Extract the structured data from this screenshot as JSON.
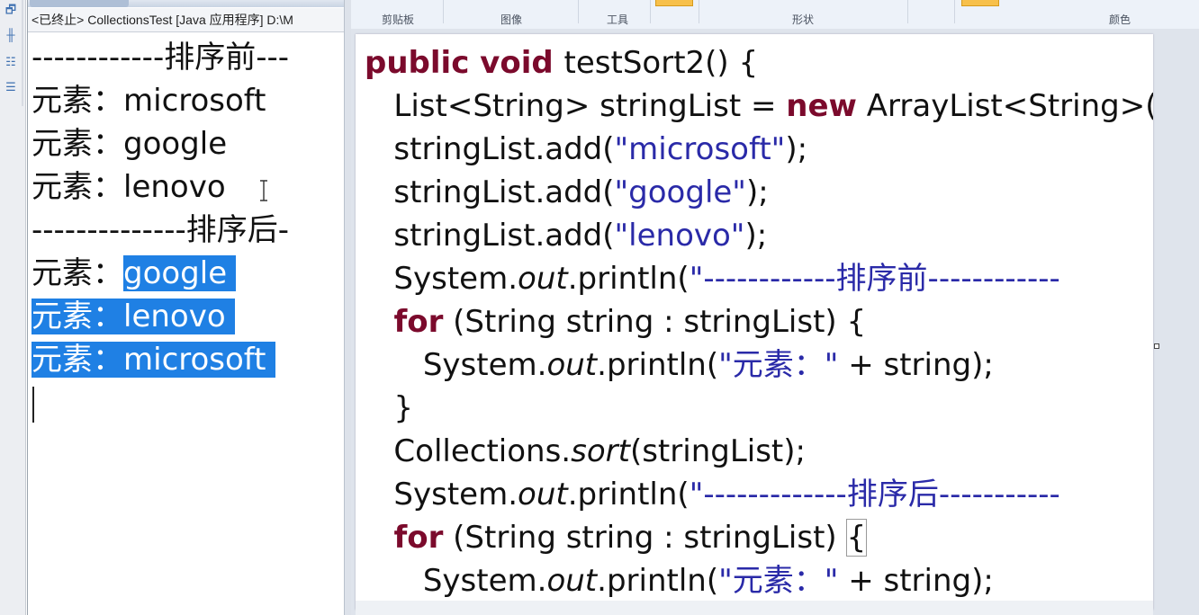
{
  "icon_strip": {
    "icons": [
      "window-restore-icon",
      "hierarchy-icon",
      "tree-icon",
      "outline-icon"
    ]
  },
  "console": {
    "header": "<已终止> CollectionsTest [Java 应用程序] D:\\M",
    "lines": [
      {
        "text": "------------排序前---",
        "selected": false
      },
      {
        "text": "元素：microsoft",
        "selected": false
      },
      {
        "text": "元素：google",
        "selected": false
      },
      {
        "text": "元素：lenovo",
        "selected": false
      },
      {
        "text": "--------------排序后-",
        "selected": false
      },
      {
        "prefix": "元素：",
        "highlight": "google",
        "selected": true
      },
      {
        "highlight": "元素：lenovo",
        "selected": true
      },
      {
        "highlight": "元素：microsoft",
        "selected": true
      }
    ]
  },
  "ribbon": {
    "groups": [
      "剪贴板",
      "图像",
      "工具",
      "形状",
      "颜色"
    ]
  },
  "editor": {
    "lines": [
      [
        {
          "t": "public void ",
          "c": "kw"
        },
        {
          "t": "testSort2() {"
        }
      ],
      [
        {
          "t": "   List<String> stringList = "
        },
        {
          "t": "new",
          "c": "kw"
        },
        {
          "t": " ArrayList<String>("
        }
      ],
      [
        {
          "t": "   stringList.add("
        },
        {
          "t": "\"microsoft\"",
          "c": "str"
        },
        {
          "t": ");"
        }
      ],
      [
        {
          "t": "   stringList.add("
        },
        {
          "t": "\"google\"",
          "c": "str"
        },
        {
          "t": ");"
        }
      ],
      [
        {
          "t": "   stringList.add("
        },
        {
          "t": "\"lenovo\"",
          "c": "str"
        },
        {
          "t": ");"
        }
      ],
      [
        {
          "t": "   System."
        },
        {
          "t": "out",
          "c": "it"
        },
        {
          "t": ".println("
        },
        {
          "t": "\"------------排序前------------",
          "c": "str"
        }
      ],
      [
        {
          "t": "   "
        },
        {
          "t": "for",
          "c": "kw"
        },
        {
          "t": " (String string : stringList) {"
        }
      ],
      [
        {
          "t": "      System."
        },
        {
          "t": "out",
          "c": "it"
        },
        {
          "t": ".println("
        },
        {
          "t": "\"元素：\"",
          "c": "str"
        },
        {
          "t": " + string);"
        }
      ],
      [
        {
          "t": "   }"
        }
      ],
      [
        {
          "t": "   Collections."
        },
        {
          "t": "sort",
          "c": "it"
        },
        {
          "t": "(stringList);"
        }
      ],
      [
        {
          "t": "   System."
        },
        {
          "t": "out",
          "c": "it"
        },
        {
          "t": ".println("
        },
        {
          "t": "\"-------------排序后-----------",
          "c": "str"
        }
      ],
      [
        {
          "t": "   "
        },
        {
          "t": "for",
          "c": "kw"
        },
        {
          "t": " (String string : stringList) "
        },
        {
          "t": "{",
          "c": "box"
        }
      ],
      [
        {
          "t": "      System."
        },
        {
          "t": "out",
          "c": "it"
        },
        {
          "t": ".println("
        },
        {
          "t": "\"元素：\"",
          "c": "str"
        },
        {
          "t": " + string);"
        }
      ]
    ]
  }
}
